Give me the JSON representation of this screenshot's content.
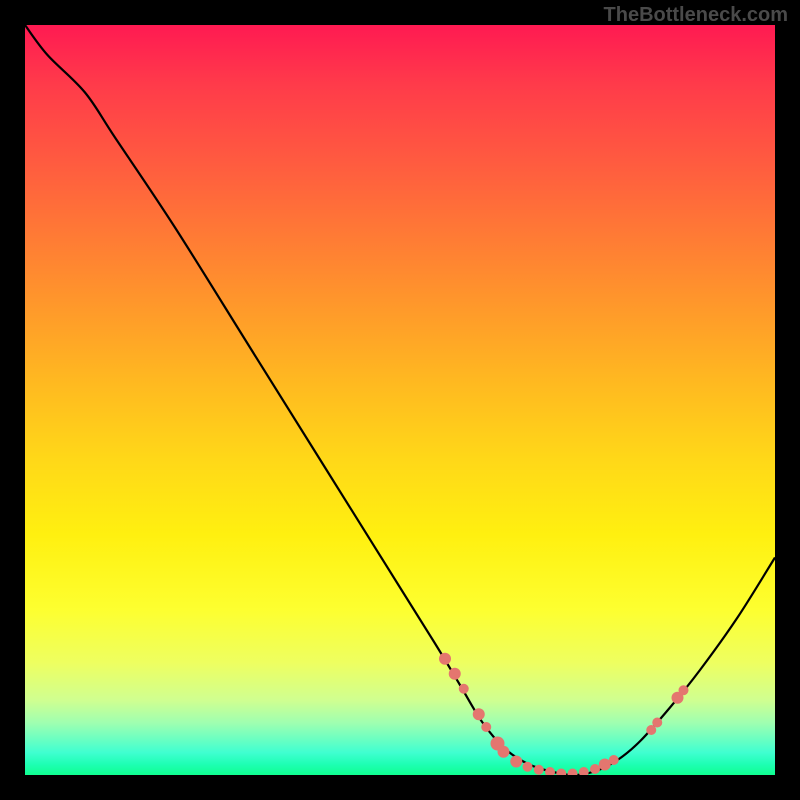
{
  "watermark": "TheBottleneck.com",
  "chart_data": {
    "type": "line",
    "title": "",
    "xlabel": "",
    "ylabel": "",
    "xlim": [
      0,
      100
    ],
    "ylim": [
      0,
      100
    ],
    "curve": [
      {
        "x": 0,
        "y": 100
      },
      {
        "x": 3,
        "y": 96
      },
      {
        "x": 8,
        "y": 91
      },
      {
        "x": 12,
        "y": 85
      },
      {
        "x": 20,
        "y": 73
      },
      {
        "x": 30,
        "y": 57
      },
      {
        "x": 40,
        "y": 41
      },
      {
        "x": 50,
        "y": 25
      },
      {
        "x": 55,
        "y": 17
      },
      {
        "x": 58,
        "y": 12
      },
      {
        "x": 61,
        "y": 7
      },
      {
        "x": 64,
        "y": 3.5
      },
      {
        "x": 67,
        "y": 1.5
      },
      {
        "x": 70,
        "y": 0.5
      },
      {
        "x": 73,
        "y": 0
      },
      {
        "x": 76,
        "y": 0.5
      },
      {
        "x": 79,
        "y": 2
      },
      {
        "x": 82,
        "y": 4.5
      },
      {
        "x": 86,
        "y": 9
      },
      {
        "x": 90,
        "y": 14
      },
      {
        "x": 95,
        "y": 21
      },
      {
        "x": 100,
        "y": 29
      }
    ],
    "markers": [
      {
        "x": 56,
        "y": 15.5,
        "r": 6
      },
      {
        "x": 57.3,
        "y": 13.5,
        "r": 6
      },
      {
        "x": 58.5,
        "y": 11.5,
        "r": 5
      },
      {
        "x": 60.5,
        "y": 8.1,
        "r": 6
      },
      {
        "x": 61.5,
        "y": 6.4,
        "r": 5
      },
      {
        "x": 63,
        "y": 4.2,
        "r": 7
      },
      {
        "x": 63.8,
        "y": 3.1,
        "r": 6
      },
      {
        "x": 65.5,
        "y": 1.8,
        "r": 6
      },
      {
        "x": 67,
        "y": 1.1,
        "r": 5
      },
      {
        "x": 68.5,
        "y": 0.7,
        "r": 5
      },
      {
        "x": 70,
        "y": 0.4,
        "r": 5
      },
      {
        "x": 71.5,
        "y": 0.2,
        "r": 5
      },
      {
        "x": 73,
        "y": 0.2,
        "r": 5
      },
      {
        "x": 74.5,
        "y": 0.4,
        "r": 5
      },
      {
        "x": 76,
        "y": 0.8,
        "r": 5
      },
      {
        "x": 77.3,
        "y": 1.4,
        "r": 6
      },
      {
        "x": 78.5,
        "y": 2,
        "r": 5
      },
      {
        "x": 83.5,
        "y": 6,
        "r": 5
      },
      {
        "x": 84.3,
        "y": 7,
        "r": 5
      },
      {
        "x": 87,
        "y": 10.3,
        "r": 6
      },
      {
        "x": 87.8,
        "y": 11.3,
        "r": 5
      }
    ]
  }
}
